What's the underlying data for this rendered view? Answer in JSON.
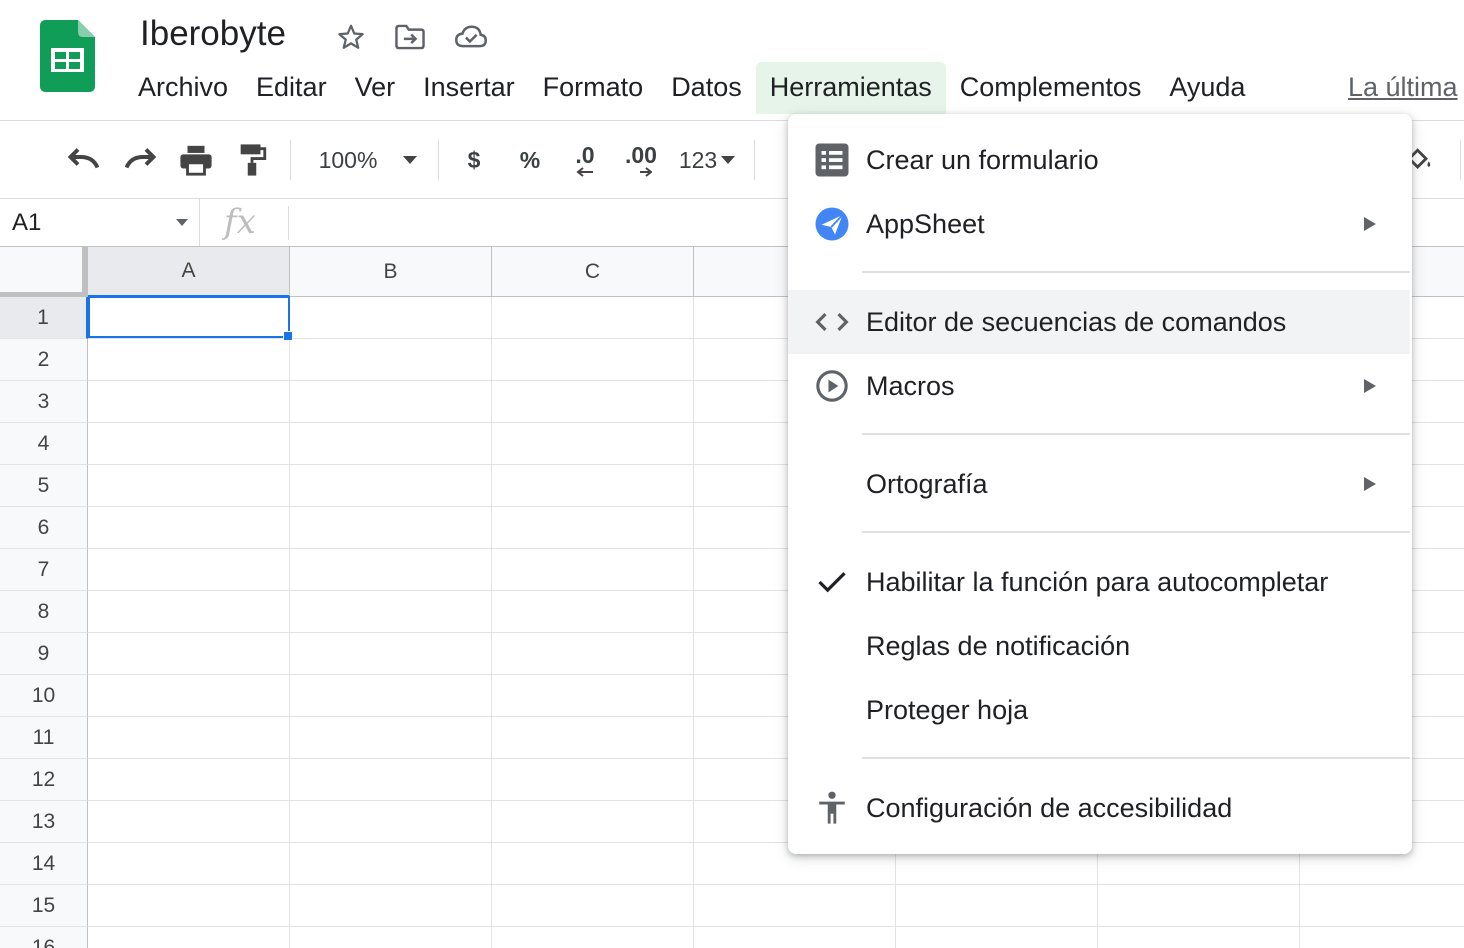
{
  "header": {
    "title": "Iberobyte",
    "last_edit": "La última"
  },
  "menubar": {
    "items": [
      "Archivo",
      "Editar",
      "Ver",
      "Insertar",
      "Formato",
      "Datos",
      "Herramientas",
      "Complementos",
      "Ayuda"
    ],
    "active": "Herramientas"
  },
  "toolbar": {
    "zoom": "100%",
    "currency": "$",
    "percent": "%",
    "decrease_decimals": ".0",
    "increase_decimals": ".00",
    "more_formats": "123"
  },
  "formula_bar": {
    "cell_ref": "A1",
    "fx": "fx"
  },
  "grid": {
    "columns": [
      "A",
      "B",
      "C"
    ],
    "rows": [
      "1",
      "2",
      "3",
      "4",
      "5",
      "6",
      "7",
      "8",
      "9",
      "10",
      "11",
      "12",
      "13",
      "14",
      "15",
      "16"
    ],
    "selected_cell": "A1"
  },
  "tools_menu": {
    "items": [
      {
        "label": "Crear un formulario",
        "icon": "form-icon",
        "submenu": false
      },
      {
        "label": "AppSheet",
        "icon": "appsheet-icon",
        "submenu": true
      },
      {
        "label": "Editor de secuencias de comandos",
        "icon": "code-icon",
        "submenu": false,
        "highlighted": true
      },
      {
        "label": "Macros",
        "icon": "play-circle-icon",
        "submenu": true
      },
      {
        "label": "Ortografía",
        "icon": "",
        "submenu": true
      },
      {
        "label": "Habilitar la función para autocompletar",
        "icon": "check-icon",
        "submenu": false,
        "checked": true
      },
      {
        "label": "Reglas de notificación",
        "icon": "",
        "submenu": false
      },
      {
        "label": "Proteger hoja",
        "icon": "",
        "submenu": false
      },
      {
        "label": "Configuración de accesibilidad",
        "icon": "accessibility-icon",
        "submenu": false
      }
    ]
  },
  "colors": {
    "sheets_green": "#0f9d58",
    "selection_blue": "#1a73e8",
    "menu_active_bg": "#e6f4ea",
    "menu_hover_bg": "#f1f3f4"
  }
}
